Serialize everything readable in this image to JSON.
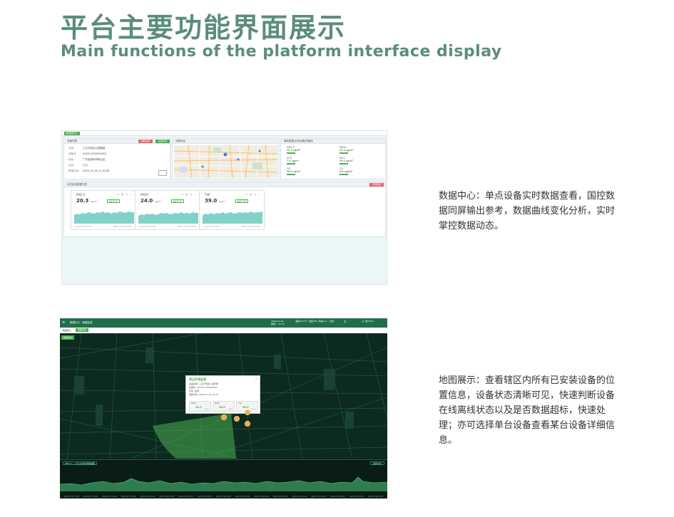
{
  "heading": {
    "title_cn": "平台主要功能界面展示",
    "title_en": "Main functions of the platform interface display"
  },
  "data_center": {
    "tag": "● 数据中心",
    "device_panel": {
      "title": "设备详情",
      "btn_red": "编辑设备",
      "btn_green": "设备列表",
      "rows": [
        {
          "k": "名称:",
          "v": "工业开发区公园智能"
        },
        {
          "k": "设备号:",
          "v": "202011020000001"
        },
        {
          "k": "地址:",
          "v": "广东省深圳市南山区"
        },
        {
          "k": "状态:",
          "v": "在线"
        },
        {
          "k": "数据时间:",
          "v": "2020-11-18 11:10:56"
        }
      ]
    },
    "map_panel": {
      "title": "设备地址"
    },
    "latest_panel": {
      "title": "最新数据(在线设备的最新)",
      "items": [
        {
          "name": "PM2.5",
          "value": "20.3 ug/m³"
        },
        {
          "name": "PM10",
          "value": "24.0 ug/m³"
        },
        {
          "name": "SO2",
          "value": "7.5 ug/m³"
        },
        {
          "name": "NO2",
          "value": "39.0 ug/m³"
        },
        {
          "name": "O3",
          "value": "38.5 ug/m³"
        },
        {
          "name": "CO",
          "value": "0.8 mg/m³"
        }
      ]
    },
    "realtime_panel": {
      "title": "实时监测数据列表",
      "btn_red": "导出数据",
      "cards": [
        {
          "name": "PM2.5",
          "value": "20.3",
          "unit": "ug/m³",
          "badge": "超标正常",
          "t1": "11-11 18 13:20:00",
          "t2": "2020-11-18 13:20:00"
        },
        {
          "name": "PM10",
          "value": "24.0",
          "unit": "ug/m³",
          "badge": "超标正常",
          "t1": "11-11 18 13:20:00",
          "t2": "2020-11-18 13:20:00"
        },
        {
          "name": "TSP",
          "value": "39.0",
          "unit": "ug/m³",
          "badge": "超标正常",
          "t1": "11-11 18 13:20:00",
          "t2": "2020-11-18 13:20:00"
        }
      ]
    }
  },
  "map_view": {
    "header": {
      "menu_icon": "menu-icon",
      "title": "数据中心 · 地图监测",
      "date": "2020-11-16",
      "time": "星期一 11:15",
      "weather": "温度29.4℃ / 湿度76% 风速2.6",
      "fullscreen": "全屏",
      "user": "用户8mj"
    },
    "crumb": {
      "home": "数据中心",
      "active": "地图监测"
    },
    "map_button": "设备列表",
    "popup": {
      "title": "扬尘环境监测",
      "close": "×",
      "lines": [
        "设备名称: 工业开发区公园智能",
        "设备号: 202011020000001",
        "状态: 在线",
        "更新时间: 2020-11-18 11:15"
      ],
      "minis": [
        {
          "name": "PM2.5",
          "value": "18.2",
          "unit": "ug/m³"
        },
        {
          "name": "PM10",
          "value": "28.0",
          "unit": "ug/m³"
        },
        {
          "name": "TSP",
          "value": "38.0",
          "unit": "ug/m³"
        }
      ]
    },
    "markers": [
      "1",
      "2",
      "3",
      "4"
    ],
    "trend": {
      "title": "PM2.5——近七天的检测数据图",
      "button": "返回列表",
      "ticks": [
        "2020-11-17 11:00",
        "2020-11-17 15:00",
        "2020-11-17 19:00",
        "2020-11-17 23:00",
        "2020-11-18 03:00",
        "2020-11-18 07:00",
        "2020-11-18 11:00",
        "2020-11-18 15:00",
        "2020-11-18 19:00",
        "2020-11-18 23:00",
        "2020-11-19 03:00",
        "2020-11-19 07:00",
        "2020-11-19 11:00",
        "2020-11-19 15:00",
        "2020-11-19 19:00",
        "2020-11-19 23:00",
        "2020-11-20 03:00"
      ]
    }
  },
  "descriptions": {
    "data_center": "数据中心：单点设备实时数据查看，国控数据同屏输出参考，数据曲线变化分析，实时掌控数据动态。",
    "map_view": "地图展示：查看辖区内所有已安装设备的位置信息，设备状态清晰可见，快速判断设备在线离线状态以及是否数据超标，快速处理；亦可选择单台设备查看某台设备详细信息。"
  },
  "colors": {
    "heading": "#5b8d7c",
    "accent_green": "#4caf50",
    "alert_red": "#e8626a",
    "map_header": "#1f6f4a"
  }
}
